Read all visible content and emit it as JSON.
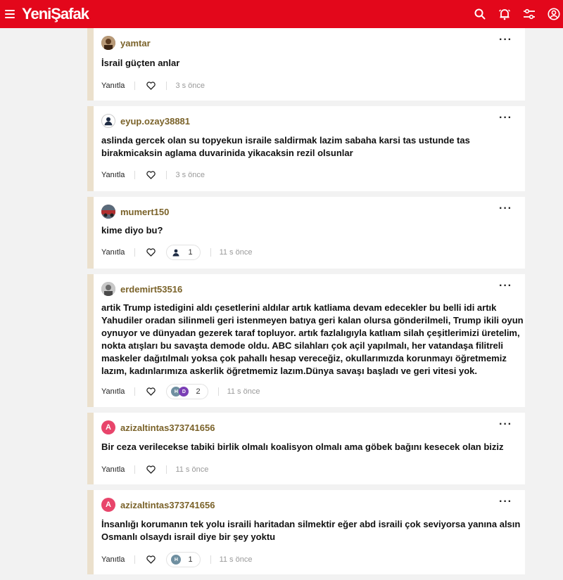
{
  "header": {
    "logo": "YeniŞafak",
    "brand_color": "#e3071b",
    "icons": [
      "menu-icon",
      "search-icon",
      "bell-icon",
      "settings-sliders-icon",
      "user-icon"
    ]
  },
  "comments": [
    {
      "username": "yamtar",
      "avatar": {
        "type": "photo",
        "color": "#6b4a2a"
      },
      "text": "İsrail güçten anlar",
      "reply_label": "Yanıtla",
      "reaction_count": "",
      "time": "3 s önce"
    },
    {
      "username": "eyup.ozay38881",
      "avatar": {
        "type": "default",
        "color": "#1f2c44"
      },
      "text": "aslinda gercek olan su topyekun israile saldirmak lazim sabaha karsi tas ustunde tas birakmicaksin aglama duvarinida yikacaksin rezil olsunlar",
      "reply_label": "Yanıtla",
      "reaction_count": "",
      "time": "3 s önce"
    },
    {
      "username": "mumert150",
      "avatar": {
        "type": "photo",
        "color": "#7a3a3a"
      },
      "text": "kime diyo bu?",
      "reply_label": "Yanıtla",
      "reaction_count": "1",
      "time": "11 s önce"
    },
    {
      "username": "erdemirt53516",
      "avatar": {
        "type": "photo",
        "color": "#8a8a8a"
      },
      "text": "artik Trump istedigini aldı çesetlerini aldılar artık katliama devam edecekler bu belli idi artık Yahudiler oradan silinmeli geri istenmeyen batıya geri kalan olursa gönderilmeli, Trump ikili oyun oynuyor ve dünyadan gezerek taraf topluyor. artık fazlalıgıyla katlıam silah çeşitlerimizi üretelim, nokta atışları bu savaşta demode oldu. ABC silahları çok açil yapılmalı, her vatandaşa filitreli maskeler dağıtılmalı yoksa çok pahallı hesap vereceğiz, okullarımızda korunmayı öğretmemiz lazım, kadınlarımıza askerlik öğretmemiz lazım.Dünya savaşı başladı ve geri vitesi yok.",
      "reply_label": "Yanıtla",
      "reaction_count": "2",
      "time": "11 s önce"
    },
    {
      "username": "azizaltintas373741656",
      "avatar": {
        "type": "letter",
        "letter": "A",
        "color": "#e8456b"
      },
      "text": "Bir ceza verilecekse tabiki birlik olmalı koalisyon olmalı ama göbek bağını kesecek olan biziz",
      "reply_label": "Yanıtla",
      "reaction_count": "",
      "time": "11 s önce"
    },
    {
      "username": "azizaltintas373741656",
      "avatar": {
        "type": "letter",
        "letter": "A",
        "color": "#e8456b"
      },
      "text": "İnsanlığı korumanın tek yolu israili haritadan silmektir eğer abd israili çok seviyorsa yanına alsın Osmanlı olsaydı israil diye bir şey yoktu",
      "reply_label": "Yanıtla",
      "reaction_count": "1",
      "time": "11 s önce"
    }
  ]
}
